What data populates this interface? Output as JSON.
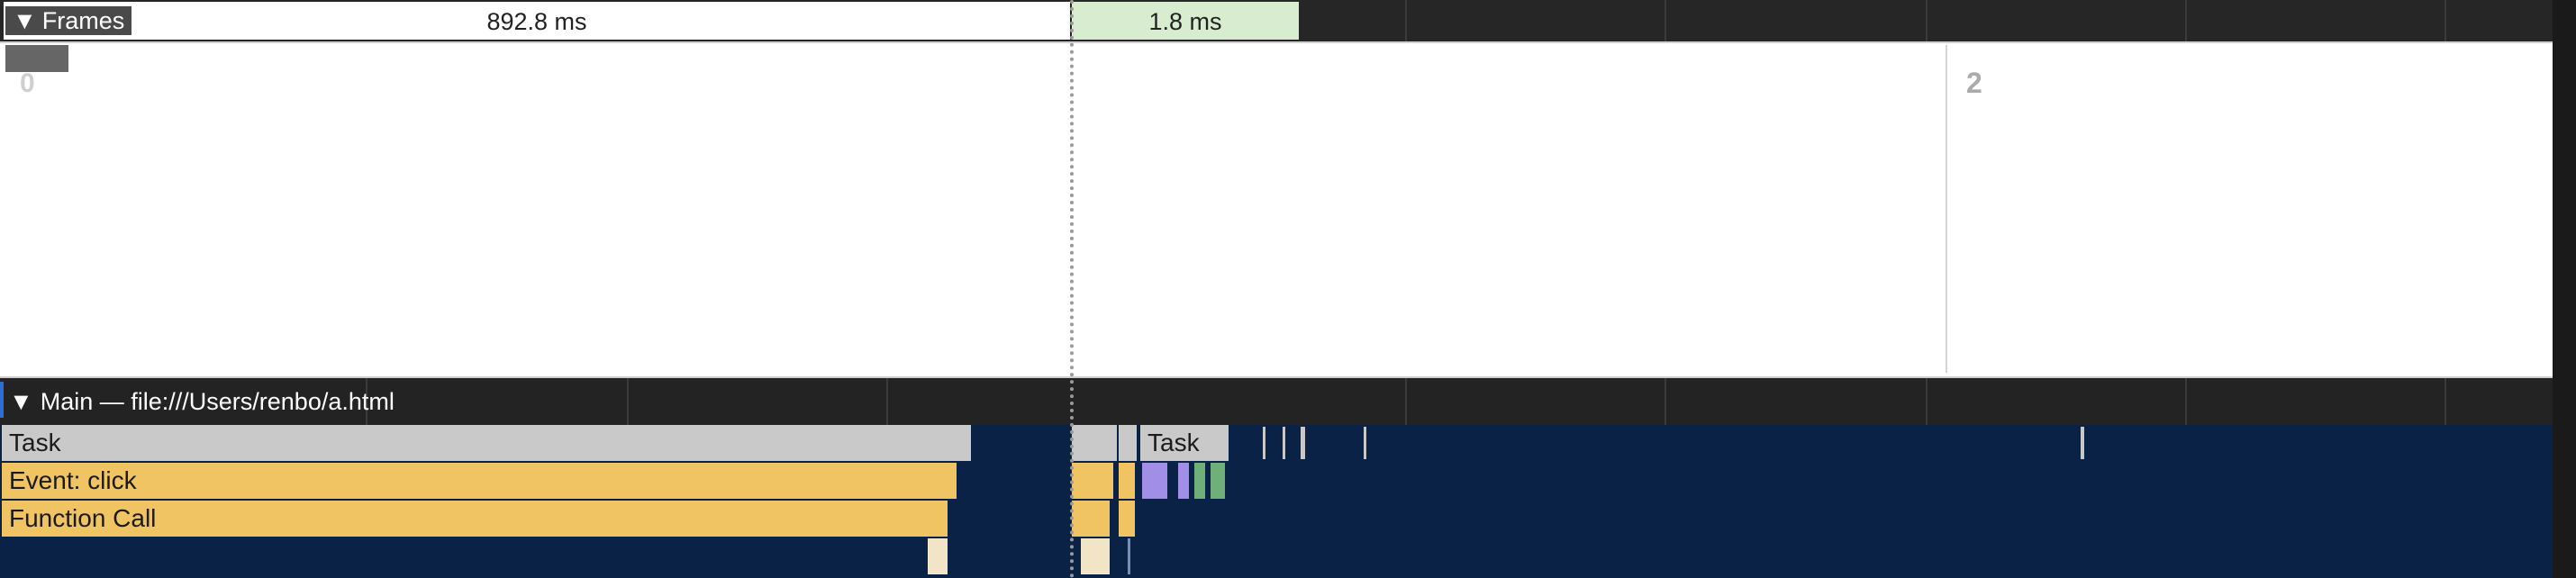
{
  "frames": {
    "toggle_label": "Frames",
    "frame_1_duration": "892.8 ms",
    "frame_2_duration": "1.8 ms",
    "thumbnail_1_index": "0",
    "thumbnail_2_index": "2"
  },
  "main_track": {
    "title": "Main — file:///Users/renbo/a.html",
    "rows": {
      "task_label": "Task",
      "task_label_2": "Task",
      "event_label": "Event: click",
      "function_label": "Function Call"
    }
  },
  "colors": {
    "task": "#c9c9c9",
    "event": "#f0c462",
    "track_background": "#0b2247",
    "frame_highlight": "#d8ecd0",
    "purple_event": "#a18ee6",
    "green_event": "#6fb07a"
  },
  "icons": {
    "collapse_toggle": "triangle-down-icon"
  }
}
